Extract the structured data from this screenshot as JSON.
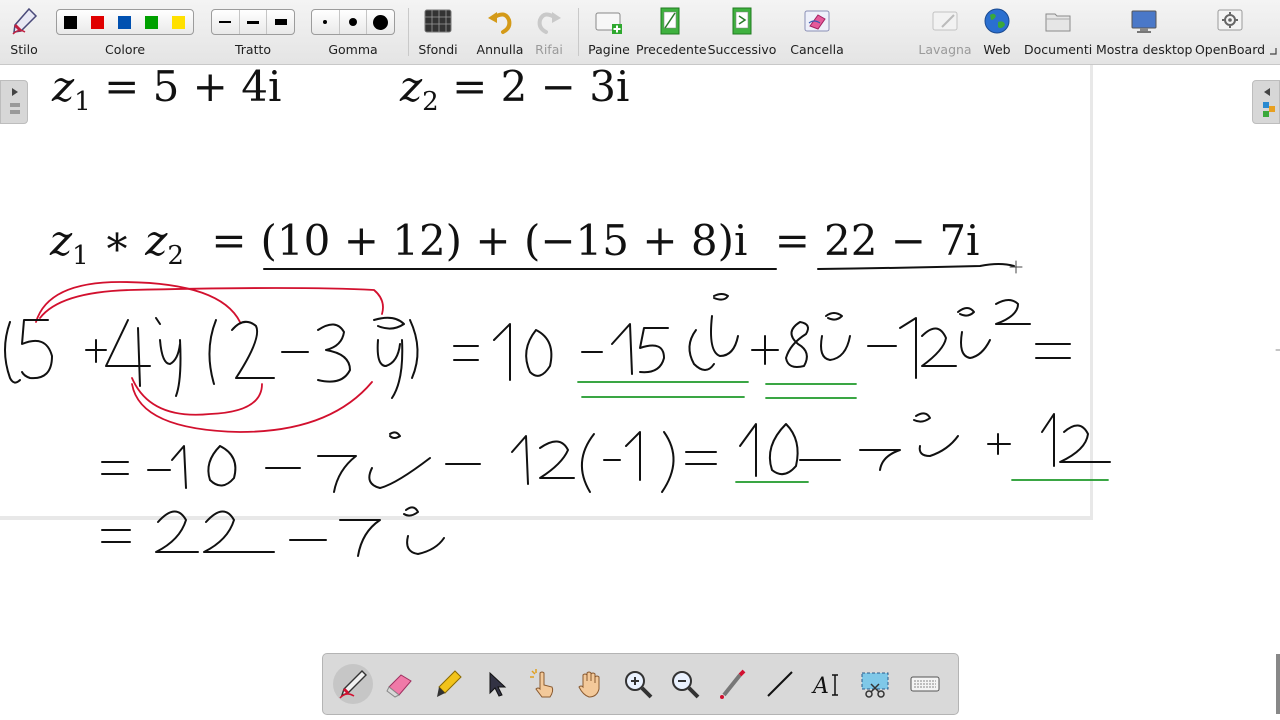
{
  "toolbar": {
    "style_label": "Stilo",
    "color_label": "Colore",
    "stroke_label": "Tratto",
    "eraser_label": "Gomma",
    "backgrounds_label": "Sfondi",
    "undo_label": "Annulla",
    "redo_label": "Rifai",
    "pages_label": "Pagine",
    "previous_label": "Precedente",
    "next_label": "Successivo",
    "clear_label": "Cancella",
    "board_label": "Lavagna",
    "web_label": "Web",
    "documents_label": "Documenti",
    "desktop_label": "Mostra desktop",
    "app_label": "OpenBoard",
    "colors": [
      "#000000",
      "#e00000",
      "#0050b0",
      "#00a000",
      "#ffe000"
    ]
  },
  "board": {
    "z1_value": "= 5 + 4i",
    "z2_value": "= 2 − 3i",
    "product_lhs": "∗",
    "product_mid": "(10 + 12) + (−15 + 8)i",
    "product_rhs": "22 − 7i",
    "ink_colors": {
      "black": "#111111",
      "red": "#d2102e",
      "green": "#1f9a2a"
    }
  },
  "dock": {
    "tools": [
      "pen-tool",
      "eraser-tool",
      "highlighter-tool",
      "pointer-tool",
      "interact-tool",
      "hand-tool",
      "zoom-in-tool",
      "zoom-out-tool",
      "laser-tool",
      "line-tool",
      "text-tool",
      "capture-tool",
      "keyboard-tool"
    ],
    "active_tool": "pen-tool"
  }
}
